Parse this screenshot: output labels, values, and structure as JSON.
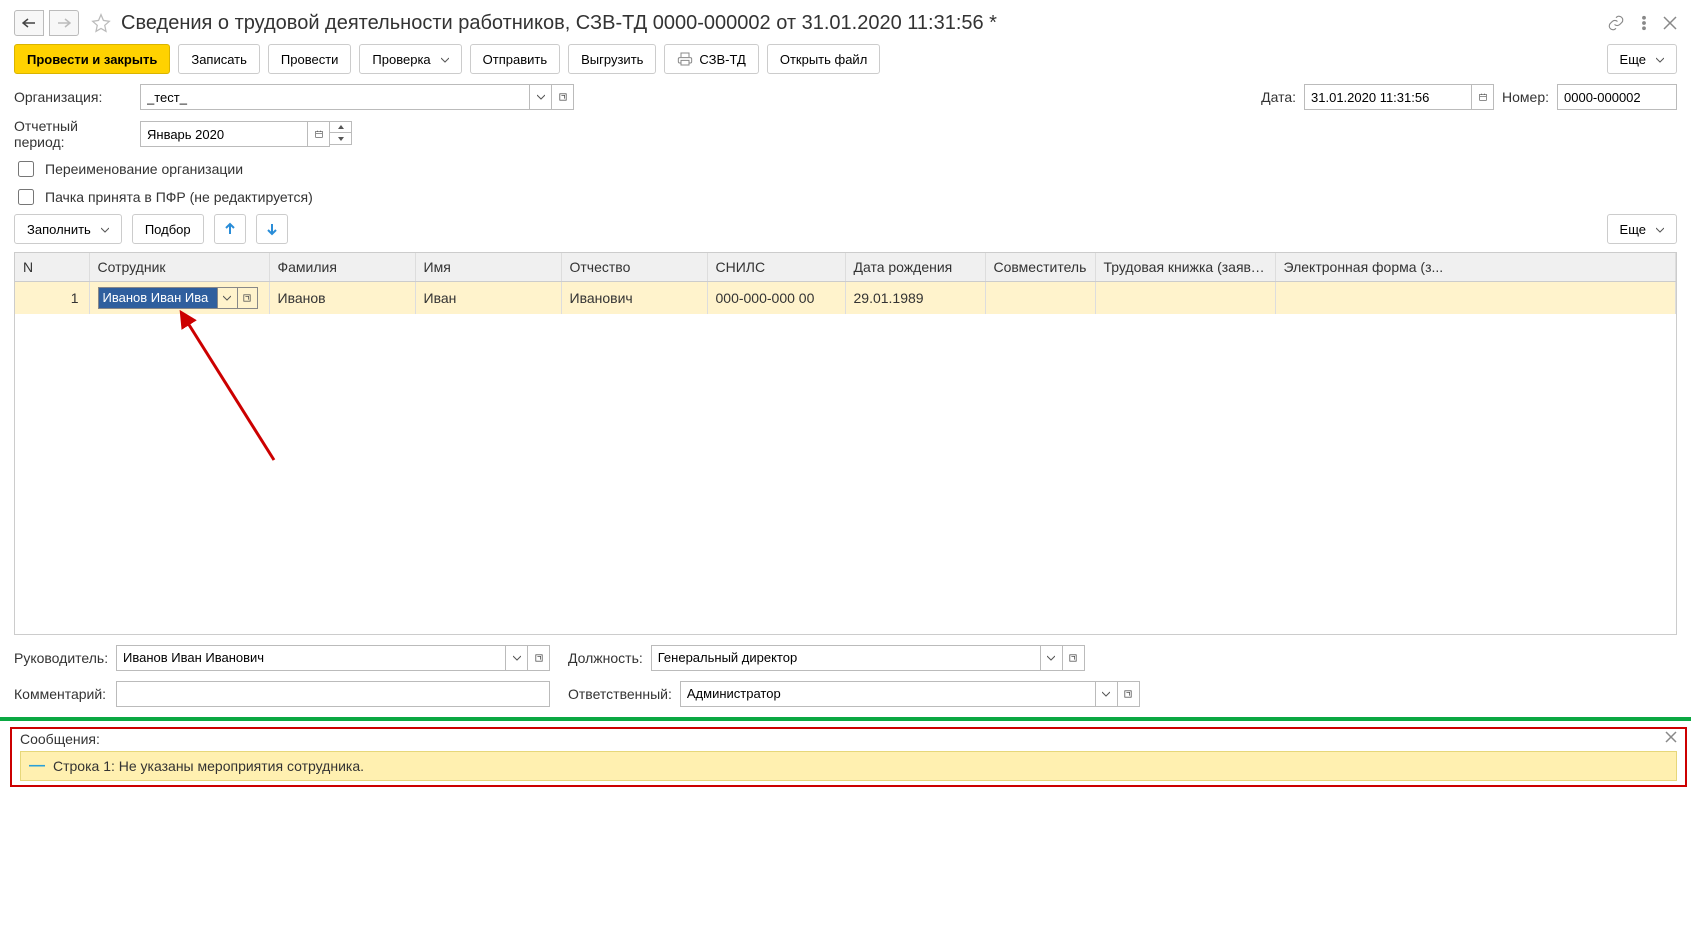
{
  "header": {
    "title": "Сведения о трудовой деятельности работников, СЗВ-ТД 0000-000002 от 31.01.2020 11:31:56 *"
  },
  "toolbar": {
    "post_close": "Провести и закрыть",
    "write": "Записать",
    "post": "Провести",
    "check": "Проверка",
    "send": "Отправить",
    "upload": "Выгрузить",
    "szvtd": "СЗВ-ТД",
    "open_file": "Открыть файл",
    "more": "Еще"
  },
  "form": {
    "org_label": "Организация:",
    "org_value": "_тест_",
    "date_label": "Дата:",
    "date_value": "31.01.2020 11:31:56",
    "number_label": "Номер:",
    "number_value": "0000-000002",
    "period_label": "Отчетный период:",
    "period_value": "Январь 2020",
    "rename_org": "Переименование организации",
    "accepted_pfr": "Пачка принята в ПФР (не редактируется)"
  },
  "sub_toolbar": {
    "fill": "Заполнить",
    "pick": "Подбор",
    "more": "Еще"
  },
  "table": {
    "cols": {
      "n": "N",
      "emp": "Сотрудник",
      "fam": "Фамилия",
      "name": "Имя",
      "patr": "Отчество",
      "snils": "СНИЛС",
      "dob": "Дата рождения",
      "comb": "Совместитель",
      "book": "Трудовая книжка (заявл.)",
      "eform": "Электронная форма (з..."
    },
    "rows": [
      {
        "n": "1",
        "emp": "Иванов Иван Ива",
        "fam": "Иванов",
        "name": "Иван",
        "patr": "Иванович",
        "snils": "000-000-000 00",
        "dob": "29.01.1989",
        "comb": "",
        "book": "",
        "eform": ""
      }
    ]
  },
  "bottom": {
    "head_label": "Руководитель:",
    "head_value": "Иванов Иван Иванович",
    "post_label": "Должность:",
    "post_value": "Генеральный директор",
    "comment_label": "Комментарий:",
    "comment_value": "",
    "resp_label": "Ответственный:",
    "resp_value": "Администратор"
  },
  "messages": {
    "title": "Сообщения:",
    "items": [
      "Строка 1: Не указаны мероприятия сотрудника."
    ]
  }
}
